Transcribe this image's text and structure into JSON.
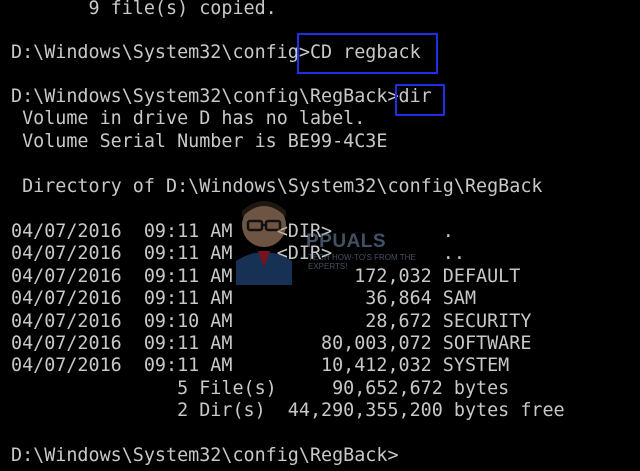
{
  "console": {
    "lines": [
      "       9 file(s) copied.",
      "",
      "D:\\Windows\\System32\\config>CD regback",
      "",
      "D:\\Windows\\System32\\config\\RegBack>dir",
      " Volume in drive D has no label.",
      " Volume Serial Number is BE99-4C3E",
      "",
      " Directory of D:\\Windows\\System32\\config\\RegBack",
      "",
      "04/07/2016  09:11 AM    <DIR>          .",
      "04/07/2016  09:11 AM    <DIR>          ..",
      "04/07/2016  09:11 AM           172,032 DEFAULT",
      "04/07/2016  09:11 AM            36,864 SAM",
      "04/07/2016  09:10 AM            28,672 SECURITY",
      "04/07/2016  09:11 AM        80,003,072 SOFTWARE",
      "04/07/2016  09:11 AM        10,412,032 SYSTEM",
      "               5 File(s)     90,652,672 bytes",
      "               2 Dir(s)  44,290,355,200 bytes free",
      "",
      "D:\\Windows\\System32\\config\\RegBack>"
    ]
  },
  "highlights": {
    "cd_command": "CD regback",
    "dir_command": "dir",
    "color": "#1f2fe8"
  },
  "watermark": {
    "brand": "PPUALS",
    "tagline": "TECH HOW-TO'S FROM THE EXPERTS!"
  },
  "colors": {
    "background": "#000000",
    "text": "#c8c8c8"
  }
}
